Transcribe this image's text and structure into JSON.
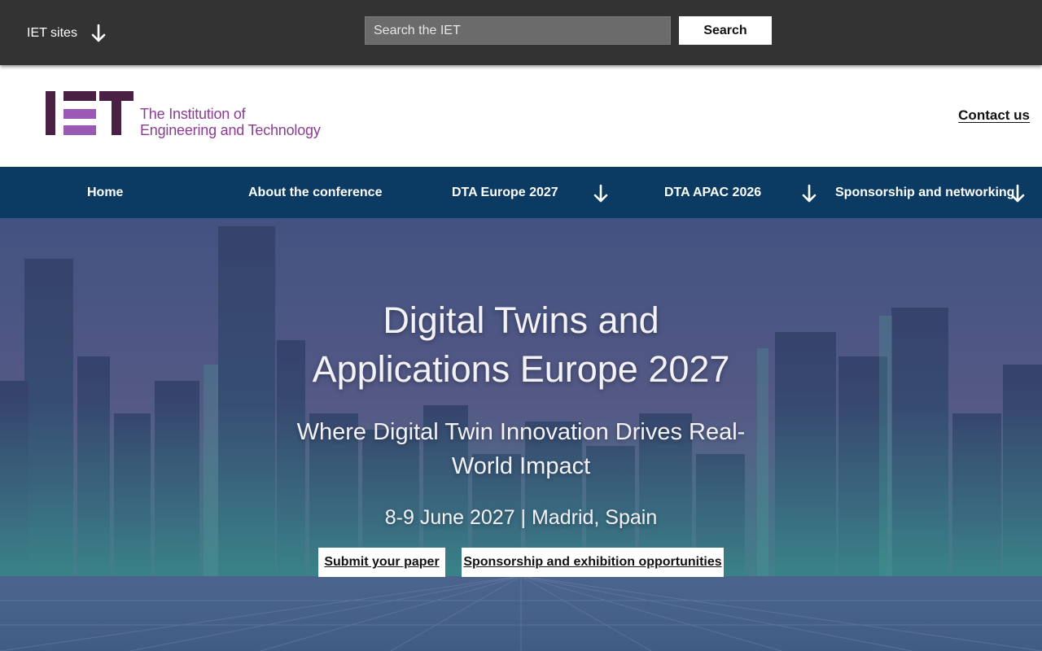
{
  "utility_bar": {
    "sites_label": "IET sites",
    "search_placeholder": "Search the IET",
    "search_button": "Search"
  },
  "brand": {
    "logo_line1": "The Institution of",
    "logo_line2": "Engineering and Technology",
    "contact_link": "Contact us",
    "logo_colors": {
      "dark": "#4a2145",
      "purple": "#8a3d93",
      "light_purple": "#9b59b6"
    }
  },
  "nav": {
    "background": "#0b3a63",
    "items": [
      {
        "label": "Home",
        "has_dropdown": false
      },
      {
        "label": "About the conference",
        "has_dropdown": false
      },
      {
        "label": "DTA Europe 2027",
        "has_dropdown": true
      },
      {
        "label": "DTA APAC 2026",
        "has_dropdown": true
      },
      {
        "label": "Sponsorship and networking",
        "has_dropdown": true
      }
    ]
  },
  "hero": {
    "title_line1": "Digital Twins and",
    "title_line2": "Applications Europe 2027",
    "subtitle_line1": "Where Digital Twin Innovation Drives Real-",
    "subtitle_line2": "World Impact",
    "date_location": "8-9 June 2027 | Madrid, Spain",
    "cta_primary": "Submit your paper",
    "cta_secondary": "Sponsorship and exhibition opportunities"
  },
  "icons": {
    "dropdown": "arrow-down-icon"
  }
}
